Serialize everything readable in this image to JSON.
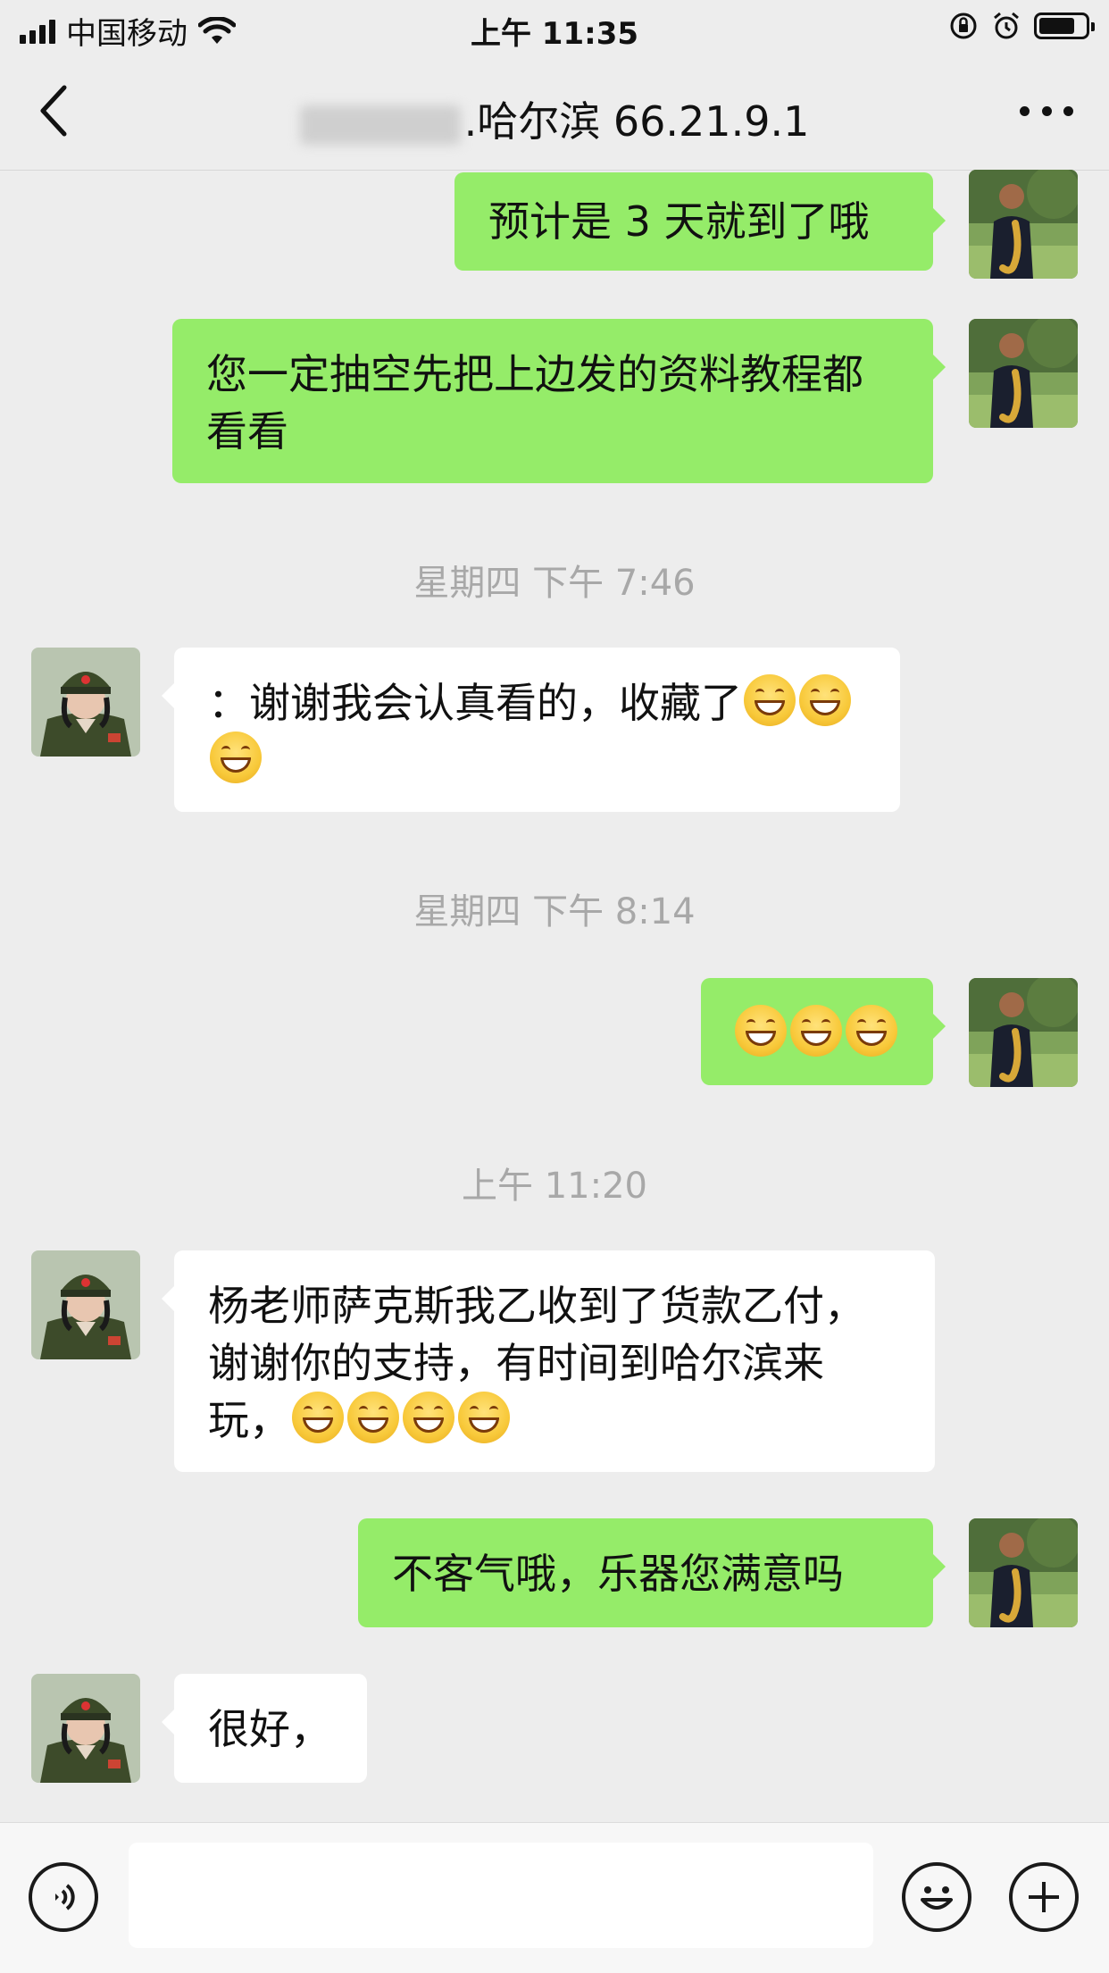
{
  "status_bar": {
    "carrier": "中国移动",
    "time": "上午 11:35"
  },
  "nav": {
    "title": ".哈尔滨 66.21.9.1"
  },
  "messages": [
    {
      "text": "预计是 3 天就到了哦"
    },
    {
      "text": "您一定抽空先把上边发的资料教程都看看"
    },
    {
      "text": "：谢谢我会认真看的，收藏了"
    },
    {
      "text": ""
    },
    {
      "text": "杨老师萨克斯我乙收到了货款乙付，谢谢你的支持，有时间到哈尔滨来玩，"
    },
    {
      "text": "不客气哦，乐器您满意吗"
    },
    {
      "text": "很好，"
    }
  ],
  "timestamps": [
    "星期四 下午 7:46",
    "星期四 下午 8:14",
    "上午 11:20"
  ],
  "input": {
    "value": ""
  },
  "colors": {
    "self_bubble": "#95ec69",
    "other_bubble": "#ffffff",
    "background": "#ededed"
  },
  "icons": [
    "back-chevron-icon",
    "more-dots-icon",
    "voice-icon",
    "emoji-icon",
    "plus-icon",
    "grinning-emoji-icon"
  ]
}
